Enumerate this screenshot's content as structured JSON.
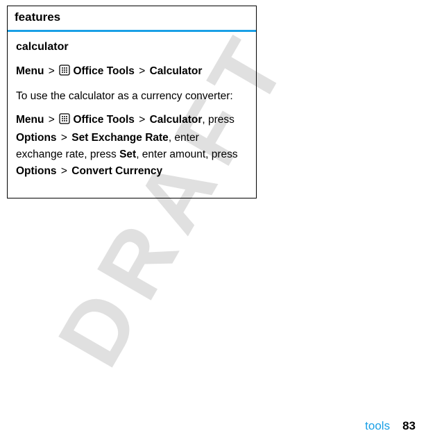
{
  "watermark": "DRAFT",
  "table": {
    "header": "features",
    "row_title": "calculator",
    "path1": {
      "menu": "Menu",
      "gt1": ">",
      "office_tools": "Office Tools",
      "gt2": ">",
      "calculator": "Calculator"
    },
    "desc": "To use the calculator as a currency converter:",
    "path2": {
      "menu": "Menu",
      "gt1": ">",
      "office_tools": "Office Tools",
      "gt2": ">",
      "calculator": "Calculator",
      "press1": ", press ",
      "options": "Options",
      "gt3": ">",
      "set_rate": "Set Exchange Rate",
      "enter_rate": ", enter exchange rate, press ",
      "set": "Set",
      "enter_amount": ", enter amount, press ",
      "options2": "Options",
      "gt4": ">",
      "convert": "Convert Currency"
    }
  },
  "footer": {
    "section": "tools",
    "page": "83"
  }
}
